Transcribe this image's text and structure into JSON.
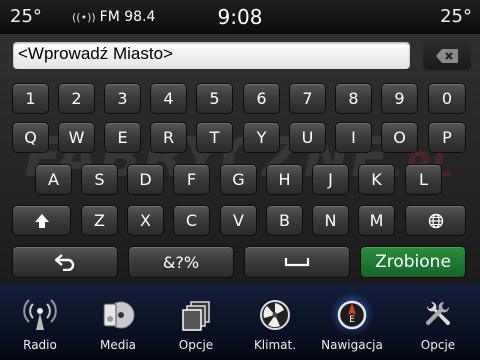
{
  "status": {
    "temp_left": "25°",
    "radio": "FM 98.4",
    "clock": "9:08",
    "temp_right": "25°"
  },
  "entry": {
    "placeholder_text": "<Wprowadź Miasto>"
  },
  "keyboard": {
    "row_numbers": [
      "1",
      "2",
      "3",
      "4",
      "5",
      "6",
      "7",
      "8",
      "9",
      "0"
    ],
    "row_top": [
      "Q",
      "W",
      "E",
      "R",
      "T",
      "Y",
      "U",
      "I",
      "O",
      "P"
    ],
    "row_mid": [
      "A",
      "S",
      "D",
      "F",
      "G",
      "H",
      "J",
      "K",
      "L"
    ],
    "row_low": [
      "Z",
      "X",
      "C",
      "V",
      "B",
      "N",
      "M"
    ],
    "symbols_label": "&?%",
    "done_label": "Zrobione"
  },
  "watermark": {
    "main": "FABRYCZNE",
    "suffix": ".PL"
  },
  "dock": [
    {
      "label": "Radio",
      "icon": "radio-icon"
    },
    {
      "label": "Media",
      "icon": "media-icon"
    },
    {
      "label": "Opcje",
      "icon": "apps-icon"
    },
    {
      "label": "Klimat.",
      "icon": "climate-icon"
    },
    {
      "label": "Nawigacja",
      "icon": "navigation-compass-icon"
    },
    {
      "label": "Opcje",
      "icon": "settings-wrench-icon"
    }
  ],
  "colors": {
    "done_green": "#1f7a32",
    "dock_blue": "#0a1124",
    "nav_glow": "#5aa0ff"
  }
}
